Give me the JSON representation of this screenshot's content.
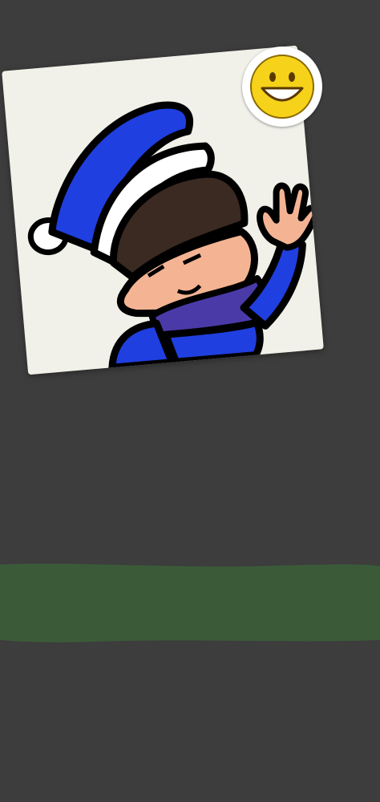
{
  "screen": {
    "background_color": "#3d3d3d"
  },
  "sticker": {
    "kind": "hand-drawn character waving, wearing a blue winter hat and scarf",
    "paper_color": "#f1f1ea",
    "hat_color": "#1f3fe0",
    "hair_color": "#3a2a22",
    "skin_color": "#f4b493",
    "scarf_color": "#4a3aa8"
  },
  "emoji_badge": {
    "icon": "grinning-face-emoji",
    "face_color": "#f6d21a"
  },
  "drawing_band": {
    "color": "#3b5b38"
  }
}
